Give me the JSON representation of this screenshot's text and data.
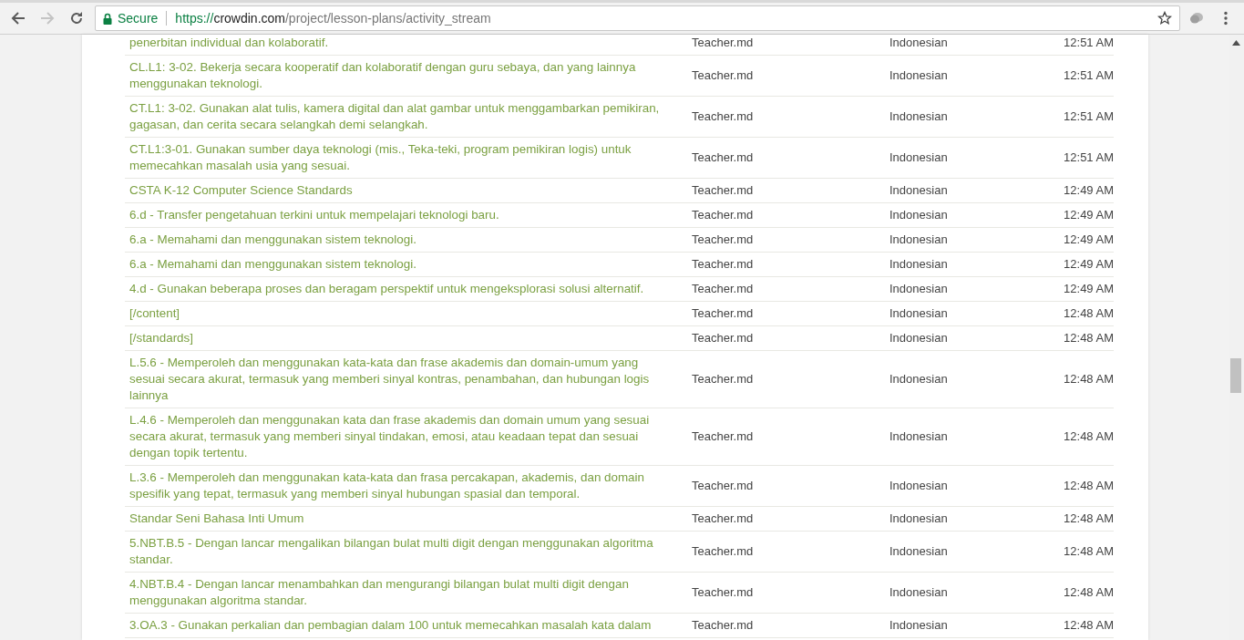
{
  "browser": {
    "security_label": "Secure",
    "url": "https://crowdin.com/project/lesson-plans/activity_stream",
    "forward_disabled": true
  },
  "activity": {
    "rows": [
      {
        "text": "penerbitan individual dan kolaboratif.",
        "file": "Teacher.md",
        "language": "Indonesian",
        "time": "12:51 AM"
      },
      {
        "text": "CL.L1: 3-02. Bekerja secara kooperatif dan kolaboratif dengan guru sebaya, dan yang lainnya menggunakan teknologi.",
        "file": "Teacher.md",
        "language": "Indonesian",
        "time": "12:51 AM"
      },
      {
        "text": "CT.L1: 3-02. Gunakan alat tulis, kamera digital dan alat gambar untuk menggambarkan pemikiran, gagasan, dan cerita secara selangkah demi selangkah.",
        "file": "Teacher.md",
        "language": "Indonesian",
        "time": "12:51 AM"
      },
      {
        "text": "CT.L1:3-01. Gunakan sumber daya teknologi (mis., Teka-teki, program pemikiran logis) untuk memecahkan masalah usia yang sesuai.",
        "file": "Teacher.md",
        "language": "Indonesian",
        "time": "12:51 AM"
      },
      {
        "text": "CSTA K-12 Computer Science Standards",
        "file": "Teacher.md",
        "language": "Indonesian",
        "time": "12:49 AM"
      },
      {
        "text": "6.d - Transfer pengetahuan terkini untuk mempelajari teknologi baru.",
        "file": "Teacher.md",
        "language": "Indonesian",
        "time": "12:49 AM"
      },
      {
        "text": "6.a - Memahami dan menggunakan sistem teknologi.",
        "file": "Teacher.md",
        "language": "Indonesian",
        "time": "12:49 AM"
      },
      {
        "text": "6.a - Memahami dan menggunakan sistem teknologi.",
        "file": "Teacher.md",
        "language": "Indonesian",
        "time": "12:49 AM"
      },
      {
        "text": "4.d - Gunakan beberapa proses dan beragam perspektif untuk mengeksplorasi solusi alternatif.",
        "file": "Teacher.md",
        "language": "Indonesian",
        "time": "12:49 AM"
      },
      {
        "text": "[/content]",
        "file": "Teacher.md",
        "language": "Indonesian",
        "time": "12:48 AM"
      },
      {
        "text": "[/standards]",
        "file": "Teacher.md",
        "language": "Indonesian",
        "time": "12:48 AM"
      },
      {
        "text": "L.5.6 - Memperoleh dan menggunakan kata-kata dan frase akademis dan domain-umum yang sesuai secara akurat, termasuk yang memberi sinyal kontras, penambahan, dan hubungan logis lainnya",
        "file": "Teacher.md",
        "language": "Indonesian",
        "time": "12:48 AM"
      },
      {
        "text": "L.4.6 - Memperoleh dan menggunakan kata dan frase akademis dan domain umum yang sesuai secara akurat, termasuk yang memberi sinyal tindakan, emosi, atau keadaan tepat dan sesuai dengan topik tertentu.",
        "file": "Teacher.md",
        "language": "Indonesian",
        "time": "12:48 AM"
      },
      {
        "text": "L.3.6 - Memperoleh dan menggunakan kata-kata dan frasa percakapan, akademis, dan domain spesifik yang tepat, termasuk yang memberi sinyal hubungan spasial dan temporal.",
        "file": "Teacher.md",
        "language": "Indonesian",
        "time": "12:48 AM"
      },
      {
        "text": "Standar Seni Bahasa Inti Umum",
        "file": "Teacher.md",
        "language": "Indonesian",
        "time": "12:48 AM"
      },
      {
        "text": "5.NBT.B.5 - Dengan lancar mengalikan bilangan bulat multi digit dengan menggunakan algoritma standar.",
        "file": "Teacher.md",
        "language": "Indonesian",
        "time": "12:48 AM"
      },
      {
        "text": "4.NBT.B.4 - Dengan lancar menambahkan dan mengurangi bilangan bulat multi digit dengan menggunakan algoritma standar.",
        "file": "Teacher.md",
        "language": "Indonesian",
        "time": "12:48 AM"
      },
      {
        "text": "3.OA.3 - Gunakan perkalian dan pembagian dalam 100 untuk memecahkan masalah kata dalam",
        "file": "Teacher.md",
        "language": "Indonesian",
        "time": "12:48 AM"
      }
    ]
  }
}
